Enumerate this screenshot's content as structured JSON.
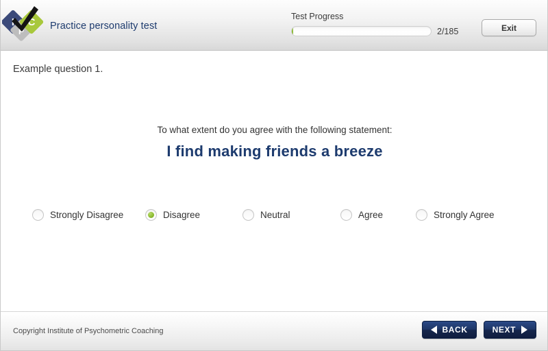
{
  "header": {
    "brand_title": "Practice personality test",
    "logo": {
      "icon": "ipc-diamond-logo",
      "letters": [
        "I",
        "P",
        "C"
      ],
      "colors": {
        "blue": "#3b4a7a",
        "gray": "#bdbdbd",
        "green": "#a8c83c",
        "check": "#1a1a1a"
      }
    },
    "progress": {
      "label": "Test Progress",
      "count_text": "2/185",
      "current": 2,
      "total": 185,
      "percent": 1
    },
    "exit_label": "Exit"
  },
  "main": {
    "example_label": "Example question 1.",
    "prompt": "To what extent do you agree with the following statement:",
    "statement": "I find making friends a breeze",
    "statement_color": "#1d3b6e",
    "options": [
      {
        "label": "Strongly Disagree",
        "selected": false
      },
      {
        "label": "Disagree",
        "selected": true
      },
      {
        "label": "Neutral",
        "selected": false
      },
      {
        "label": "Agree",
        "selected": false
      },
      {
        "label": "Strongly Agree",
        "selected": false
      }
    ],
    "selected_option": "Disagree",
    "selected_color": "#8fbd33"
  },
  "footer": {
    "copyright": "Copyright Institute of Psychometric Coaching",
    "back_label": "BACK",
    "next_label": "NEXT",
    "button_color": "#1e3666"
  }
}
